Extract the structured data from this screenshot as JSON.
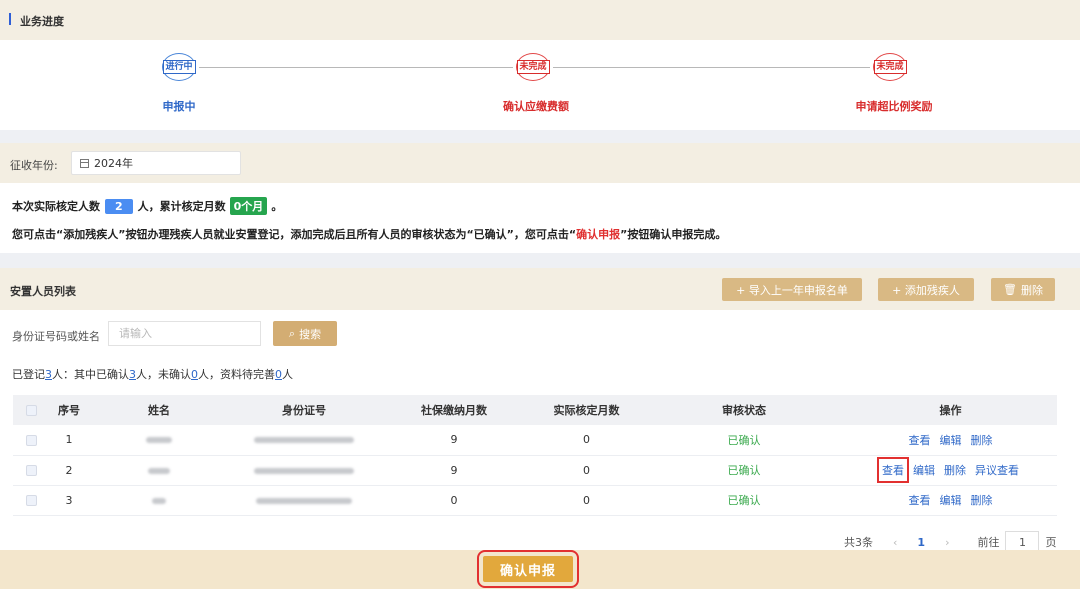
{
  "progress": {
    "title": "业务进度",
    "steps": [
      {
        "stamp": "进行中",
        "label": "申报中",
        "color": "#2f68c8"
      },
      {
        "stamp": "未完成",
        "label": "确认应缴费额",
        "color": "#d82c2c"
      },
      {
        "stamp": "未完成",
        "label": "申请超比例奖励",
        "color": "#d82c2c"
      }
    ]
  },
  "year": {
    "label": "征收年份:",
    "value": "2024年"
  },
  "summary": {
    "prefix": "本次实际核定人数",
    "count": "2",
    "mid": "人，累计核定月数",
    "months": "0个月",
    "suffix": "。"
  },
  "hint": {
    "part1": "您可点击“添加残疾人”按钮办理残疾人员就业安置登记，添加完成后且所有人员的审核状态为“已确认”，您可点击“",
    "emphasis": "确认申报",
    "part2": "”按钮确认申报完成。"
  },
  "list": {
    "title": "安置人员列表",
    "buttons": {
      "import": "+ 导入上一年申报名单",
      "add": "+ 添加残疾人",
      "delete": "删除"
    }
  },
  "search": {
    "label": "身份证号码或姓名",
    "placeholder": "请输入",
    "button": "搜索"
  },
  "counts": {
    "t1": "已登记",
    "registered": "3",
    "t2": "人：其中已确认",
    "confirmed": "3",
    "t3": "人，未确认",
    "unconfirmed": "0",
    "t4": "人，资料待完善",
    "incomplete": "0",
    "t5": "人"
  },
  "table": {
    "headers": [
      "序号",
      "姓名",
      "身份证号",
      "社保缴纳月数",
      "实际核定月数",
      "审核状态",
      "操作"
    ],
    "rows": [
      {
        "no": "1",
        "social": "9",
        "months": "0",
        "status": "已确认",
        "ops": [
          "查看",
          "编辑",
          "删除"
        ]
      },
      {
        "no": "2",
        "social": "9",
        "months": "0",
        "status": "已确认",
        "ops": [
          "查看",
          "编辑",
          "删除",
          "异议查看"
        ]
      },
      {
        "no": "3",
        "social": "0",
        "months": "0",
        "status": "已确认",
        "ops": [
          "查看",
          "编辑",
          "删除"
        ]
      }
    ]
  },
  "pager": {
    "total": "共3条",
    "prev": "‹",
    "current": "1",
    "next": "›",
    "goto": "前往",
    "page": "1",
    "unit": "页"
  },
  "footer": {
    "confirm": "确认申报"
  }
}
